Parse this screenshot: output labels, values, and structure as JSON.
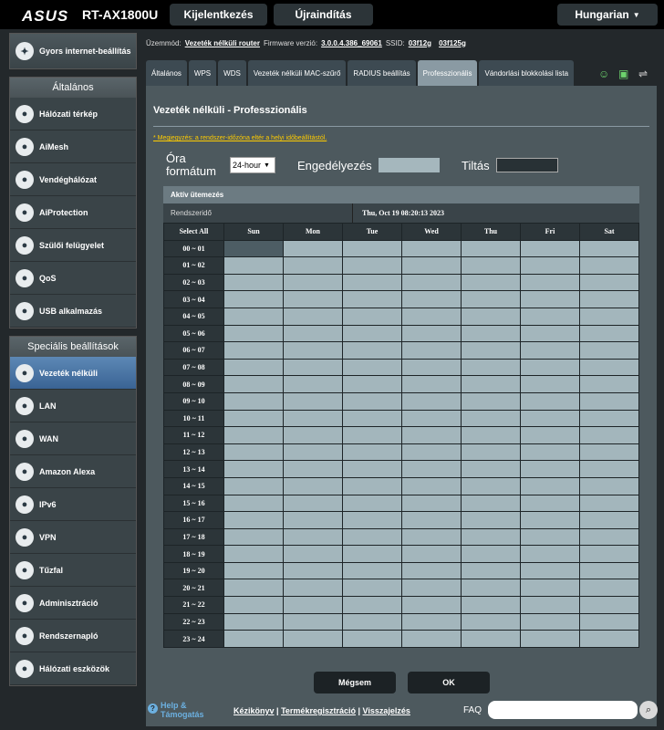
{
  "header": {
    "logo": "ASUS",
    "model": "RT-AX1800U",
    "logout": "Kijelentkezés",
    "reboot": "Újraindítás",
    "language": "Hungarian"
  },
  "info": {
    "mode_label": "Üzemmód:",
    "mode": "Vezeték nélküli router",
    "fw_label": "Firmware verzió:",
    "fw": "3.0.0.4.386_69061",
    "ssid_label": "SSID:",
    "ssid1": "03f12g",
    "ssid2": "03f125g"
  },
  "sidebar": {
    "quick": "Gyors internet-beállítás",
    "general_title": "Általános",
    "general": [
      {
        "label": "Hálózati térkép",
        "icon": "globe-icon"
      },
      {
        "label": "AiMesh",
        "icon": "mesh-icon"
      },
      {
        "label": "Vendéghálózat",
        "icon": "guest-network-icon"
      },
      {
        "label": "AiProtection",
        "icon": "lock-icon"
      },
      {
        "label": "Szülői felügyelet",
        "icon": "family-icon"
      },
      {
        "label": "QoS",
        "icon": "speed-icon"
      },
      {
        "label": "USB alkalmazás",
        "icon": "usb-icon"
      }
    ],
    "advanced_title": "Speciális beállítások",
    "advanced": [
      {
        "label": "Vezeték nélküli",
        "icon": "wifi-icon"
      },
      {
        "label": "LAN",
        "icon": "lan-icon"
      },
      {
        "label": "WAN",
        "icon": "wan-globe-icon"
      },
      {
        "label": "Amazon Alexa",
        "icon": "alexa-icon"
      },
      {
        "label": "IPv6",
        "icon": "ipv6-icon"
      },
      {
        "label": "VPN",
        "icon": "vpn-icon"
      },
      {
        "label": "Tűzfal",
        "icon": "firewall-icon"
      },
      {
        "label": "Adminisztráció",
        "icon": "admin-icon"
      },
      {
        "label": "Rendszernapló",
        "icon": "log-icon"
      },
      {
        "label": "Hálózati eszközök",
        "icon": "tools-icon"
      }
    ]
  },
  "tabs": [
    "Általános",
    "WPS",
    "WDS",
    "Vezeték nélküli MAC-szűrő",
    "RADIUS beállítás",
    "Professzionális",
    "Vándorlási blokkolási lista"
  ],
  "page": {
    "title": "Vezeték nélküli - Professzionális",
    "note": "* Megjegyzés: a rendszer-időzóna eltér a helyi időbeállítástól.",
    "format_label": "Óra formátum",
    "format_value": "24-hour",
    "allow_label": "Engedélyezés",
    "deny_label": "Tiltás"
  },
  "schedule": {
    "header": "Aktív ütemezés",
    "sys_label": "Rendszeridő",
    "sys_time": "Thu, Oct 19 08:20:13 2023",
    "select_all": "Select All",
    "days": [
      "Sun",
      "Mon",
      "Tue",
      "Wed",
      "Thu",
      "Fri",
      "Sat"
    ],
    "hours": [
      "00 ~ 01",
      "01 ~ 02",
      "02 ~ 03",
      "03 ~ 04",
      "04 ~ 05",
      "05 ~ 06",
      "06 ~ 07",
      "07 ~ 08",
      "08 ~ 09",
      "09 ~ 10",
      "10 ~ 11",
      "11 ~ 12",
      "12 ~ 13",
      "13 ~ 14",
      "14 ~ 15",
      "15 ~ 16",
      "16 ~ 17",
      "17 ~ 18",
      "18 ~ 19",
      "19 ~ 20",
      "20 ~ 21",
      "21 ~ 22",
      "22 ~ 23",
      "23 ~ 24"
    ]
  },
  "buttons": {
    "cancel": "Mégsem",
    "ok": "OK"
  },
  "footer": {
    "help": "Help &",
    "help2": "Támogatás",
    "manual": "Kézikönyv",
    "reg": "Termékregisztráció",
    "sep": "|",
    "download": "Visszajelzés",
    "faq": "FAQ"
  }
}
